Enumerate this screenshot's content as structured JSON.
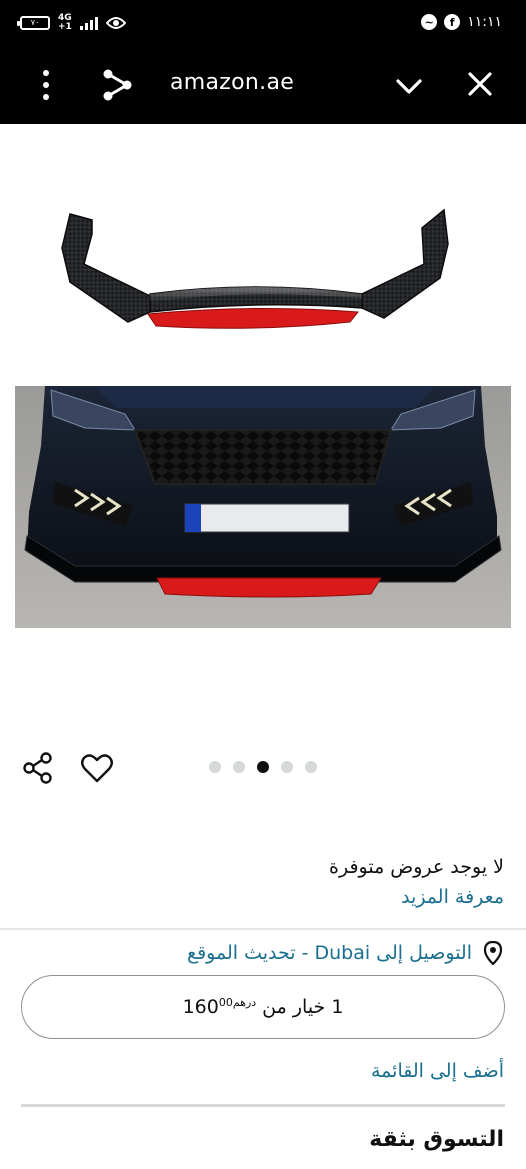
{
  "status_bar": {
    "time": "١١:١١",
    "battery": "٧٠",
    "network": "4G",
    "network_sub": "+1"
  },
  "browser": {
    "url": "amazon.ae"
  },
  "gallery": {
    "dot_count": 5,
    "active_dot": 2,
    "lip_color": "#d91a1a",
    "carbon_color": "#1b1c1e"
  },
  "offers": {
    "no_offers": "لا يوجد عروض متوفرة",
    "learn_more": "معرفة المزيد"
  },
  "delivery": {
    "text": "التوصيل إلى Dubai - تحديث الموقع"
  },
  "option": {
    "label": "1 خيار من",
    "price_whole": "160",
    "price_fraction": "00",
    "currency": "درهم"
  },
  "add_to_list": "أضف إلى القائمة",
  "shop_with_confidence": "التسوق بثقة",
  "colors": {
    "link": "#1a6f8f",
    "text": "#0f1111"
  }
}
